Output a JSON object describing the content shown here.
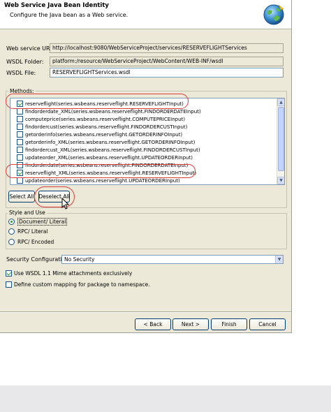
{
  "dialog": {
    "title": "Web Service Java Bean Identity",
    "description": "Configure the Java bean as a Web service."
  },
  "fields": {
    "uri_label": "Web service URI:",
    "uri_value": "http://localhost:9080/WebServiceProject/services/RESERVEFLIGHTServices",
    "folder_label": "WSDL Folder:",
    "folder_value": "platform:/resource/WebServiceProject/WebContent/WEB-INF/wsdl",
    "file_label": "WSDL File:",
    "file_value": "RESERVEFLIGHTServices.wsdl"
  },
  "methods": {
    "label": "Methods:",
    "items": [
      {
        "label": "reserveflight(series.wsbeans.reserveflight.RESERVEFLIGHTInput)",
        "checked": true
      },
      {
        "label": "findorderdate_XML(series.wsbeans.reserveflight.FINDORDERDATEInput)",
        "checked": false
      },
      {
        "label": "computeprice(series.wsbeans.reserveflight.COMPUTEPRICEInput)",
        "checked": false
      },
      {
        "label": "findordercust(series.wsbeans.reserveflight.FINDORDERCUSTInput)",
        "checked": false
      },
      {
        "label": "getorderinfo(series.wsbeans.reserveflight.GETORDERINFOInput)",
        "checked": false
      },
      {
        "label": "getorderinfo_XML(series.wsbeans.reserveflight.GETORDERINFOInput)",
        "checked": false
      },
      {
        "label": "findordercust_XML(series.wsbeans.reserveflight.FINDORDERCUSTInput)",
        "checked": false
      },
      {
        "label": "updateorder_XML(series.wsbeans.reserveflight.UPDATEORDERInput)",
        "checked": false
      },
      {
        "label": "findorderdate(series.wsbeans.reserveflight.FINDORDERDATEInput)",
        "checked": false
      },
      {
        "label": "reserveflight_XML(series.wsbeans.reserveflight.RESERVEFLIGHTInput)",
        "checked": true
      },
      {
        "label": "updateorder(series.wsbeans.reserveflight.UPDATEORDERInput)",
        "checked": false
      }
    ],
    "select_all": "Select All",
    "deselect_all": "Deselect All"
  },
  "style": {
    "label": "Style and Use",
    "options": [
      {
        "label": "Document/ Literal",
        "selected": true
      },
      {
        "label": "RPC/ Literal",
        "selected": false
      },
      {
        "label": "RPC/ Encoded",
        "selected": false
      }
    ]
  },
  "security": {
    "label": "Security Configuration",
    "value": "No Security"
  },
  "options": {
    "mime_label": "Use WSDL 1.1 Mime attachments exclusively",
    "mime_checked": true,
    "mapping_label": "Define custom mapping for package to namespace.",
    "mapping_checked": false
  },
  "buttons": {
    "back": "< Back",
    "next": "Next >",
    "finish": "Finish",
    "cancel": "Cancel"
  },
  "colors": {
    "highlight_oval": "#e03c3c",
    "check_green": "#21a121",
    "dialog_bg": "#ece9d8"
  }
}
